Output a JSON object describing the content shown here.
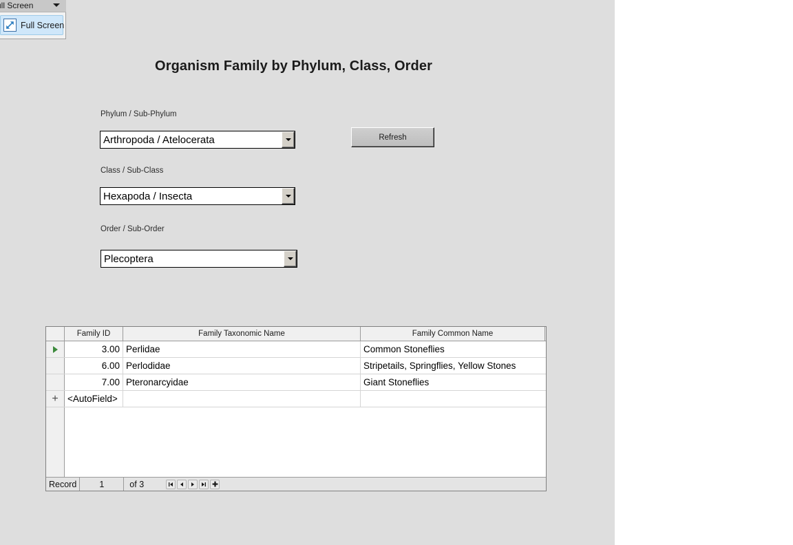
{
  "ribbon": {
    "group_label": "ull Screen",
    "chevron_icon": "chevron-down-icon",
    "menu_item_label": "Full Screen",
    "menu_item_icon": "fullscreen-arrow-icon"
  },
  "form": {
    "title": "Organism Family by Phylum, Class, Order",
    "background_color": "#dedede",
    "fields": [
      {
        "label": "Phylum / Sub-Phylum",
        "value": "Arthropoda / Atelocerata"
      },
      {
        "label": "Class / Sub-Class",
        "value": "Hexapoda / Insecta"
      },
      {
        "label": "Order / Sub-Order",
        "value": "Plecoptera"
      }
    ],
    "refresh_label": "Refresh"
  },
  "datasheet": {
    "columns": [
      "Family ID",
      "Family Taxonomic Name",
      "Family Common Name"
    ],
    "rows": [
      {
        "id": "3.00",
        "taxonomic": "Perlidae",
        "common": "Common Stoneflies",
        "selector": "current-record-arrow"
      },
      {
        "id": "6.00",
        "taxonomic": "Perlodidae",
        "common": "Stripetails, Springflies, Yellow Stones",
        "selector": ""
      },
      {
        "id": "7.00",
        "taxonomic": "Pteronarcyidae",
        "common": "Giant Stoneflies",
        "selector": ""
      }
    ],
    "new_row": {
      "id": "<AutoField>",
      "taxonomic": "",
      "common": "",
      "selector": "new-record-plus"
    },
    "selector_arrow_color": "#3c8a3c"
  },
  "record_nav": {
    "label": "Record",
    "current": "1",
    "total": "of 3",
    "buttons": [
      {
        "name": "first-record-button",
        "icon": "first-record-icon"
      },
      {
        "name": "previous-record-button",
        "icon": "previous-record-icon"
      },
      {
        "name": "next-record-button",
        "icon": "next-record-icon"
      },
      {
        "name": "last-record-button",
        "icon": "last-record-icon"
      },
      {
        "name": "new-record-button",
        "icon": "new-record-icon"
      }
    ]
  }
}
